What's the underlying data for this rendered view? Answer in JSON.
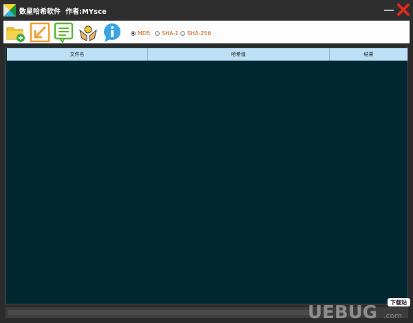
{
  "window": {
    "title": "数星哈希软件  作者:MYsce"
  },
  "toolbar": {
    "buttons": [
      {
        "name": "add-file",
        "icon": "folder-add-icon"
      },
      {
        "name": "import",
        "icon": "arrow-down-left-icon"
      },
      {
        "name": "export-list",
        "icon": "document-list-icon"
      },
      {
        "name": "donate",
        "icon": "hands-coin-icon"
      },
      {
        "name": "about",
        "icon": "info-bubble-icon"
      }
    ]
  },
  "hash_options": {
    "selected": "MD5",
    "items": [
      {
        "label": "MD5",
        "checked": true
      },
      {
        "label": "SHA-1",
        "checked": false
      },
      {
        "label": "SHA-256",
        "checked": false
      }
    ]
  },
  "table": {
    "columns": [
      "文件名",
      "哈希值",
      "结果"
    ],
    "rows": []
  },
  "watermark": {
    "logo": "UEBUG",
    "suffix": ".com",
    "badge": "下载站"
  },
  "colors": {
    "table_bg": "#012731",
    "header_bg": "#bde0f7",
    "accent_label": "#c75b12"
  }
}
